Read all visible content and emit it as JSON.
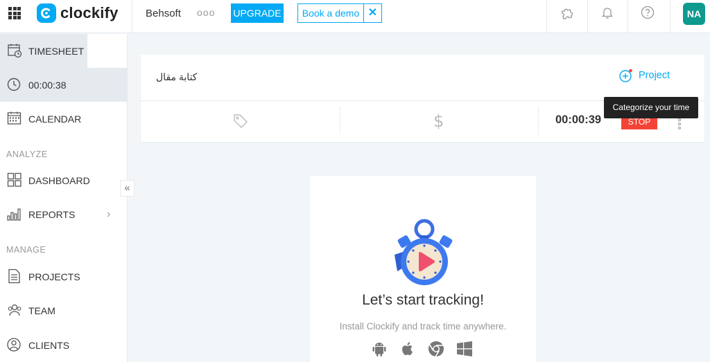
{
  "header": {
    "brand": "clockify",
    "workspace": "Behsoft",
    "more_dots": "ooo",
    "upgrade_label": "UPGRADE",
    "demo_label": "Book a demo",
    "demo_close": "✕",
    "avatar_initials": "NA",
    "icons": [
      "apps-grid-icon",
      "puzzle-icon",
      "bell-icon",
      "help-icon"
    ]
  },
  "sidebar": {
    "items": [
      {
        "label": "TIMESHEET",
        "icon": "timesheet-icon"
      },
      {
        "label": "00:00:38",
        "icon": "clock-icon"
      },
      {
        "label": "CALENDAR",
        "icon": "calendar-icon"
      },
      {
        "label": "DASHBOARD",
        "icon": "dashboard-icon"
      },
      {
        "label": "REPORTS",
        "icon": "reports-icon"
      },
      {
        "label": "PROJECTS",
        "icon": "projects-icon"
      },
      {
        "label": "TEAM",
        "icon": "team-icon"
      },
      {
        "label": "CLIENTS",
        "icon": "clients-icon"
      }
    ],
    "sections": {
      "analyze": "ANALYZE",
      "manage": "MANAGE"
    },
    "collapse_glyph": "«",
    "reports_chevron": "›"
  },
  "timer": {
    "description": "كتابة مقال",
    "project_label": "Project",
    "dollar": "$",
    "elapsed": "00:00:39",
    "stop_label": "STOP",
    "tooltip": "Categorize your time"
  },
  "empty_state": {
    "title": "Let’s start tracking!",
    "subtitle": "Install Clockify and track time anywhere.",
    "platforms": [
      "android-icon",
      "apple-icon",
      "chrome-icon",
      "windows-icon"
    ]
  },
  "colors": {
    "accent": "#03a9f4",
    "stop": "#f44336",
    "avatar": "#0f9a8e",
    "active_bg": "#e4eaee",
    "page_bg": "#f2f6f8"
  }
}
